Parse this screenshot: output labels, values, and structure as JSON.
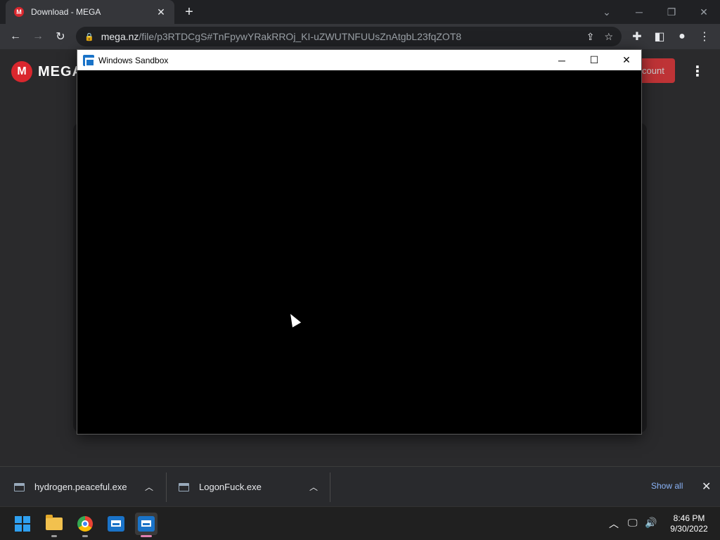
{
  "browser": {
    "tab_title": "Download - MEGA",
    "tab_favicon": "M",
    "url_host": "mega.nz",
    "url_path": "/file/p3RTDCgS#TnFpywYRakRROj_KI-uZWUTNFUUsZnAtgbL23fqZOT8"
  },
  "page": {
    "logo_mark": "M",
    "logo_text": "MEGA",
    "account_button_partial": "count"
  },
  "sandbox": {
    "title": "Windows Sandbox"
  },
  "downloads": {
    "items": [
      {
        "name": "hydrogen.peaceful.exe"
      },
      {
        "name": "LogonFuck.exe"
      }
    ],
    "show_all": "Show all"
  },
  "taskbar": {
    "time": "8:46 PM",
    "date": "9/30/2022"
  },
  "colors": {
    "mega_red": "#d9272e",
    "link_blue": "#8ab4f8"
  }
}
